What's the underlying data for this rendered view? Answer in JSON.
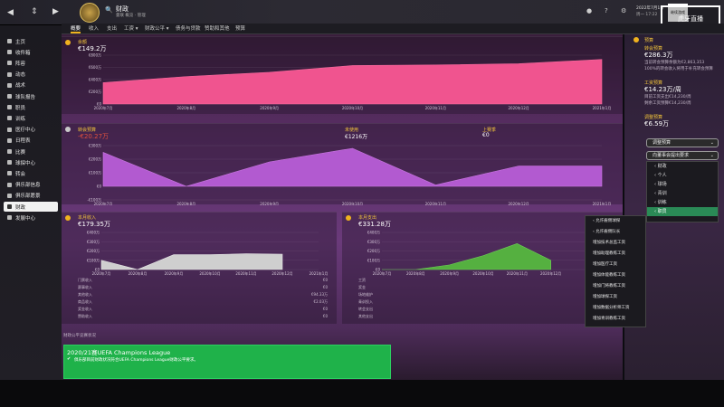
{
  "topbar": {
    "title": "财政",
    "subtitle": "曼联 概览 · 管理",
    "date": "2022年7月1日",
    "weekday": "周一 17:22",
    "continue_label": "继续游戏",
    "watermark_big": "1536828",
    "watermark_text": "虎牙直播"
  },
  "tabs": [
    "概要",
    "收入",
    "支出",
    "工资",
    "转会总览",
    "财政公平",
    "经营与转会",
    "高管与高管",
    "财政"
  ],
  "tabs_visible": [
    "概要",
    "收入",
    "支出",
    "工资 ▾",
    "财政公平 ▾",
    "债务与贷款",
    "赞助和其他",
    "预算"
  ],
  "sidebar": {
    "items": [
      "主页",
      "收件箱",
      "阵容",
      "动态",
      "战术",
      "球队报告",
      "职员",
      "训练",
      "医疗中心",
      "日程表",
      "比赛",
      "球探中心",
      "转会",
      "俱乐部信息",
      "俱乐部愿景",
      "财政",
      "发展中心"
    ]
  },
  "balance": {
    "title": "余额",
    "value": "€149.2万",
    "ticks_y": [
      "€800万",
      "€600万",
      "€400万",
      "€200万",
      "€0"
    ],
    "ticks_x": [
      "2020年7月",
      "2020年8月",
      "2020年9月",
      "2020年10月",
      "2020年11月",
      "2020年12月",
      "2021年1月"
    ]
  },
  "chart_data": [
    {
      "type": "area",
      "title": "余额",
      "x": [
        "2020年7月",
        "2020年8月",
        "2020年9月",
        "2020年10月",
        "2020年11月",
        "2020年12月",
        "2021年1月"
      ],
      "values": [
        3.5,
        4.5,
        5.2,
        6.3,
        6.4,
        6.6,
        7.3
      ],
      "ylim": [
        0,
        8
      ],
      "ylabel": "€百万"
    },
    {
      "type": "area",
      "title": "转会预算",
      "x": [
        "2020年7月",
        "2020年8月",
        "2020年9月",
        "2020年10月",
        "2020年11月",
        "2020年12月",
        "2021年1月"
      ],
      "values": [
        250,
        0,
        180,
        280,
        10,
        150,
        150
      ],
      "ylim": [
        -100,
        300
      ]
    },
    {
      "type": "area",
      "title": "本月收入",
      "x": [
        "2020年7月",
        "2020年8月",
        "2020年9月",
        "2020年10月",
        "2020年11月",
        "2020年12月",
        "2021年1月"
      ],
      "values": [
        100,
        0,
        160,
        160,
        170,
        165
      ],
      "ylim": [
        0,
        400
      ]
    },
    {
      "type": "area",
      "title": "本月支出",
      "x": [
        "2020年7月",
        "2020年8月",
        "2020年9月",
        "2020年10月",
        "2020年11月",
        "2020年12月"
      ],
      "values": [
        0,
        0,
        50,
        150,
        280,
        100
      ],
      "ylim": [
        0,
        400
      ]
    }
  ],
  "transfer": {
    "title": "转会预算",
    "value": "-€20.27万",
    "mid_label": "未使用",
    "mid_value": "€1216万",
    "right_label": "上赛季",
    "right_value": "€0"
  },
  "income": {
    "title": "本月收入",
    "value": "€179.35万",
    "rows": [
      "门票收入",
      "赛事收入",
      "其他收入",
      "商品收入",
      "奖金收入",
      "赞助收入"
    ],
    "vals": [
      "€0",
      "€0",
      "€94.33万",
      "€2.03万",
      "€0",
      "€0"
    ]
  },
  "expense": {
    "title": "本月支出",
    "value": "€331.28万",
    "rows": [
      "工资",
      "奖金",
      "场地维护",
      "青训投入",
      "转会支出",
      "其他支出"
    ],
    "vals": [
      "",
      "",
      "",
      "",
      "",
      ""
    ]
  },
  "uefa": {
    "section": "财政公平竞赛状况",
    "title": "2020/21赛UEFA Champions League",
    "text": "俱乐部目前财政状况符合UEFA Champions League财政公平要求。"
  },
  "right": {
    "budget_title": "预算",
    "remaining_label": "转会预算",
    "remaining_value": "€286.3万",
    "note1": "当前转会预算余额为€2,863,353",
    "note2": "100%的转会收入将用于补充转会预算",
    "wage_title": "工资预算",
    "wage_value": "€14.23万/周",
    "wage_note1": "目前工资支出€14,230/周",
    "wage_note2": "剩余工资预算€14,230/周",
    "adj_title": "调整预算",
    "adj_value": "€6.59万",
    "btn_adjust": "调整预算",
    "btn_ask": "向董事会提出要求"
  },
  "menu_left": [
    "财政",
    "个人",
    "球场",
    "青训",
    "训练",
    "职员"
  ],
  "menu_right": [
    "允许雇佣球探",
    "允许雇佣队长",
    "增加技术总监工资",
    "增加助理教练工资",
    "增加医疗工资",
    "增加体能教练工资",
    "增加门将教练工资",
    "增加球探工资",
    "增加数据分析师工资",
    "增加青训教练工资"
  ]
}
